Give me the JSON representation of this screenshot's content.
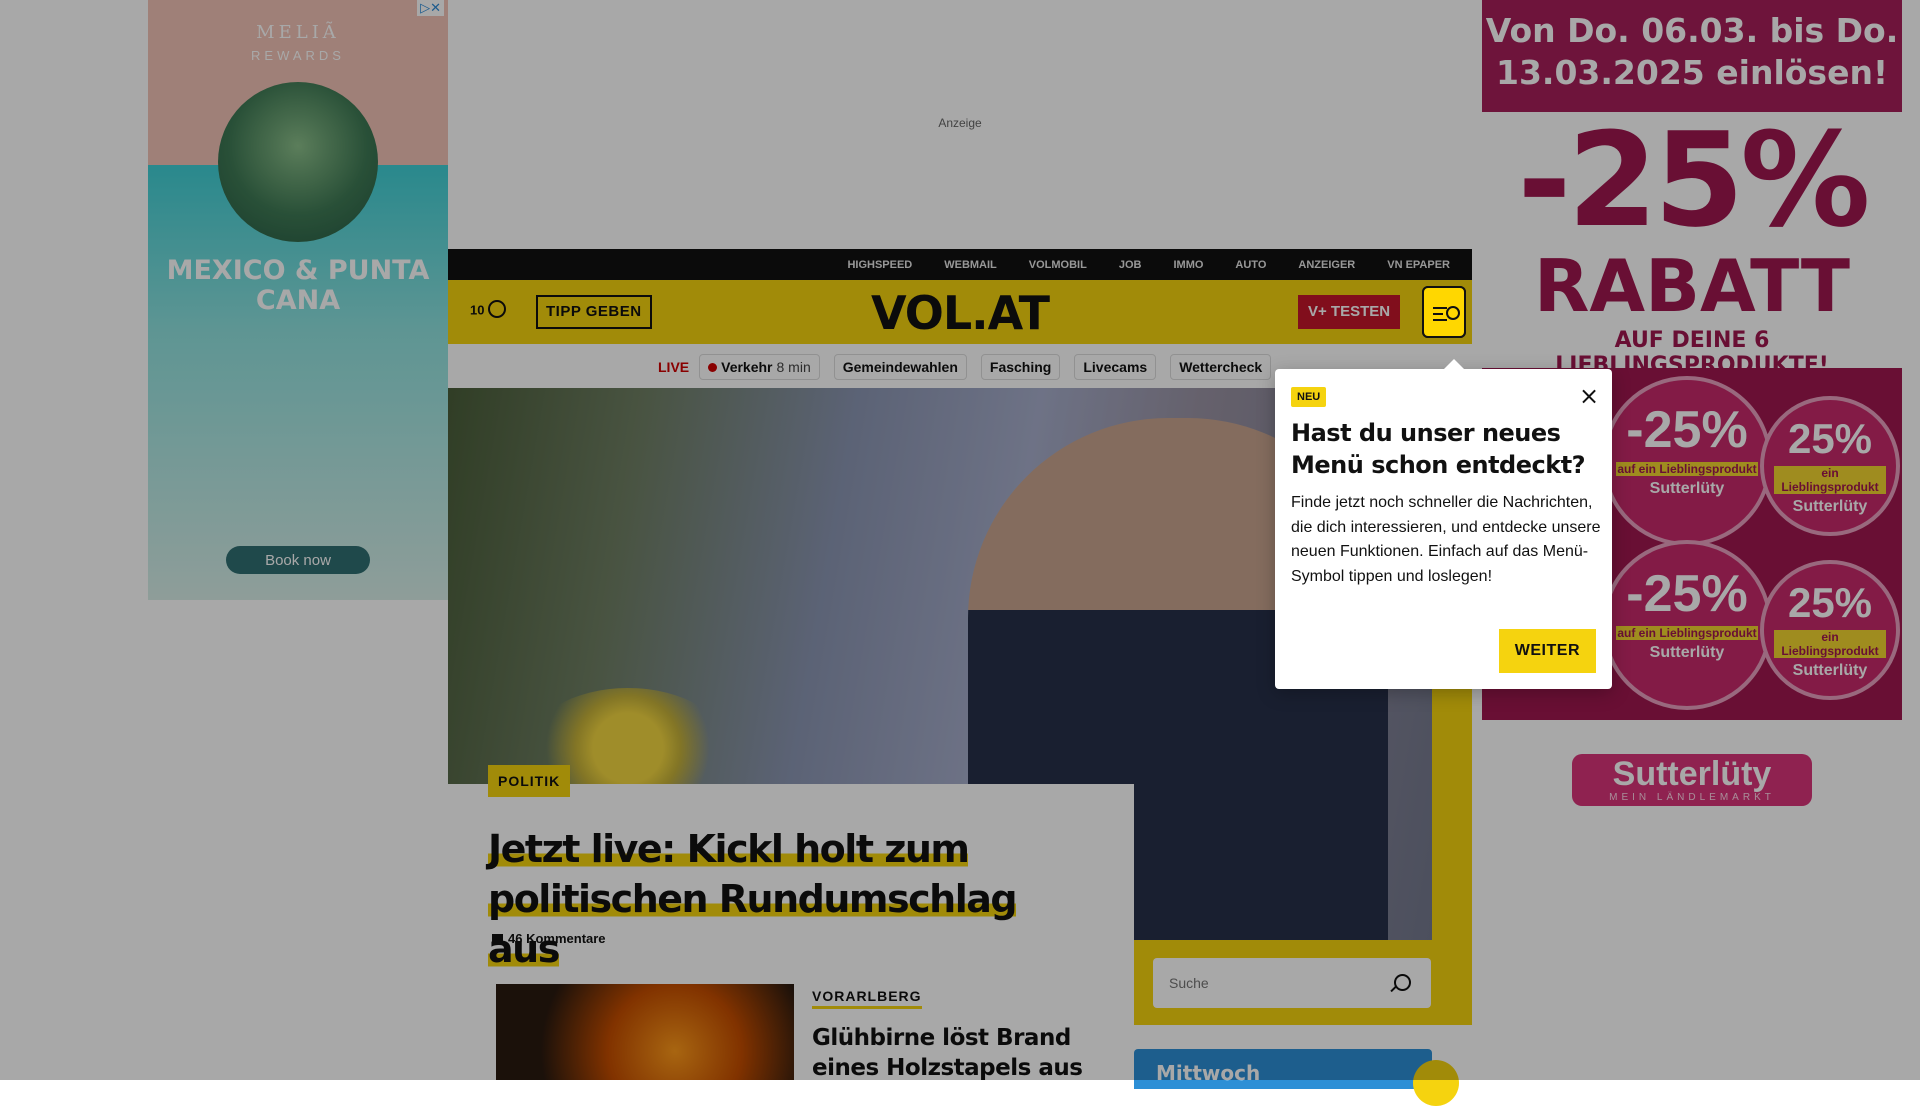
{
  "ad_left": {
    "brand": "MELIÃ",
    "brand_sub": "REWARDS",
    "headline": "MEXICO & PUNTA CANA",
    "cta": "Book now",
    "adchoices": "▷✕"
  },
  "ad_label": "Anzeige",
  "ad_right": {
    "dates": "Von Do. 06.03. bis Do. 13.03.2025 einlösen!",
    "percent": "-25%",
    "rabatt": "RABATT",
    "tagline": "AUF DEINE 6 LIEBLINGSPRODUKTE!",
    "sticker_big": "-25%",
    "sticker_band": "auf ein Lieblingsprodukt",
    "sticker_small": "25%",
    "sticker_band_small": "ein Lieblingsprodukt",
    "sticker_logo": "Sutterlüty",
    "brand": "Sutterlüty",
    "brand_sub": "MEIN LÄNDLEMARKT"
  },
  "topbar": [
    "HIGHSPEED",
    "WEBMAIL",
    "VOLMOBIL",
    "JOB",
    "IMMO",
    "AUTO",
    "ANZEIGER",
    "VN EPAPER"
  ],
  "header": {
    "temp": "10",
    "tipp": "TIPP GEBEN",
    "logo": "VOL.AT",
    "vplus": "V+ TESTEN"
  },
  "quicknav": {
    "live": "LIVE",
    "verkehr": "Verkehr",
    "verkehr_time": "8 min",
    "items": [
      "Gemeindewahlen",
      "Fasching",
      "Livecams",
      "Wettercheck"
    ]
  },
  "lead_article": {
    "category": "POLITIK",
    "title_line1": "Jetzt live: Kickl holt zum",
    "title_line2": "politischen Rundumschlag aus",
    "comments": "46 Kommentare"
  },
  "search": {
    "placeholder": "Suche"
  },
  "teaser": {
    "category": "VORARLBERG",
    "title": "Glühbirne löst Brand eines Holzstapels aus"
  },
  "weather": {
    "day": "Mittwoch"
  },
  "popover": {
    "badge": "NEU",
    "close": "×",
    "heading": "Hast du unser neues Menü schon entdeckt?",
    "body": "Finde jetzt noch schneller die Nachrichten, die dich interessieren, und entdecke unsere neuen Funktionen. Einfach auf das Menü-Symbol tippen und loslegen!",
    "button": "WEITER"
  },
  "colors": {
    "brand_yellow": "#f5d30f",
    "vplus_red": "#c4162b",
    "live_red": "#d00000",
    "weather_blue": "#2d8fd6",
    "ad_magenta": "#a0174f"
  }
}
